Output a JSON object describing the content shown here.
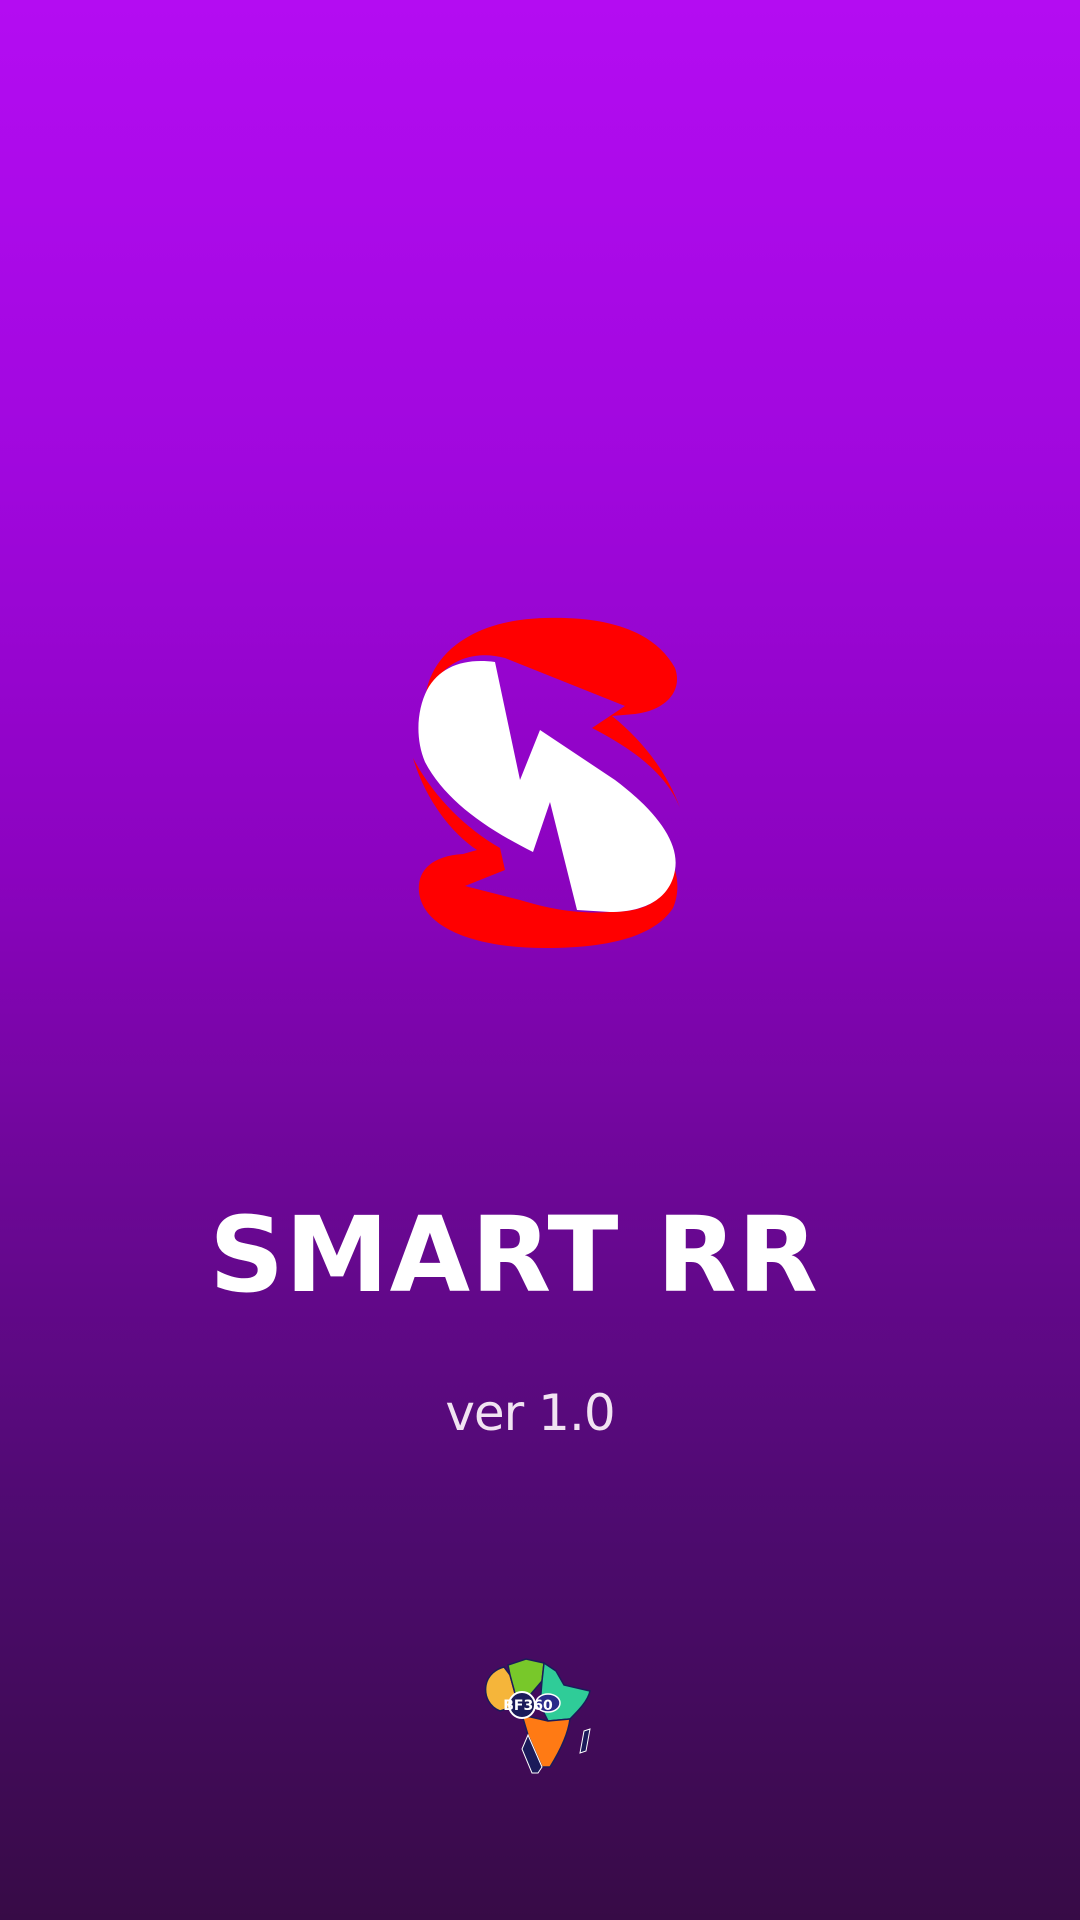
{
  "splash": {
    "app_name": "SMART RR",
    "version_label": "ver 1.0",
    "logo_icon": "smart-rr-s-arrow-logo",
    "company_logo_icon": "bf360-africa-map-logo",
    "company_logo_text": "BF360"
  },
  "colors": {
    "background_top": "#b40cf2",
    "background_bottom": "#370b46",
    "logo_red": "#ff0000",
    "logo_white": "#ffffff",
    "title_text": "#ffffff",
    "version_text": "#f1e3f2"
  }
}
